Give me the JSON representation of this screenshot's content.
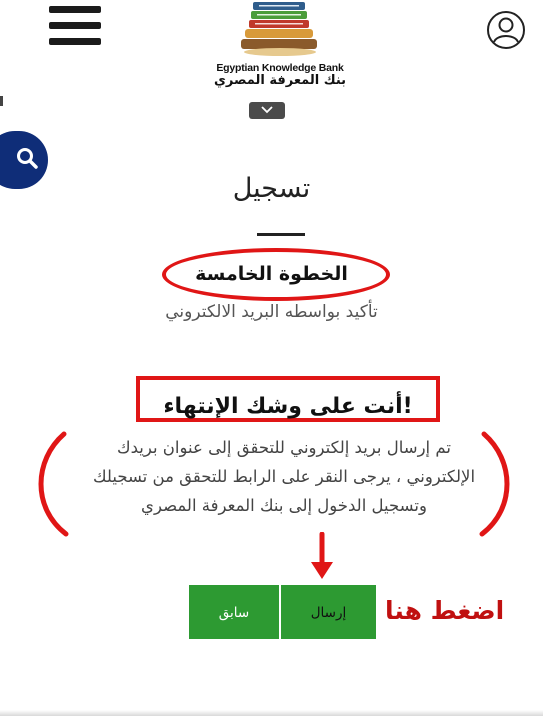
{
  "header": {
    "logo_en": "Egyptian Knowledge Bank",
    "logo_ar": "بنك المعرفة المصري",
    "menu_icon": "hamburger-icon",
    "user_icon": "user-circle-icon",
    "dropdown_icon": "chevron-down-icon"
  },
  "search": {
    "icon": "search-icon",
    "color": "#0f2d78"
  },
  "page": {
    "title": "تسجيل",
    "step_title": "الخطوة الخامسة",
    "step_subtitle": "تأكيد بواسطه البريد الالكتروني"
  },
  "callout": {
    "almost_done": "!أنت على وشك الإنتهاء"
  },
  "message": {
    "line1": "تم إرسال بريد إلكتروني للتحقق إلى عنوان بريدك",
    "line2": "الإلكتروني ، يرجى النقر على الرابط للتحقق من تسجيلك",
    "line3": "وتسجيل الدخول إلى بنك المعرفة المصري"
  },
  "buttons": {
    "previous": "سابق",
    "send": "إرسال",
    "color": "#2d9a32"
  },
  "annotation": {
    "click_here": "اضغط هنا",
    "color": "#e01616"
  }
}
